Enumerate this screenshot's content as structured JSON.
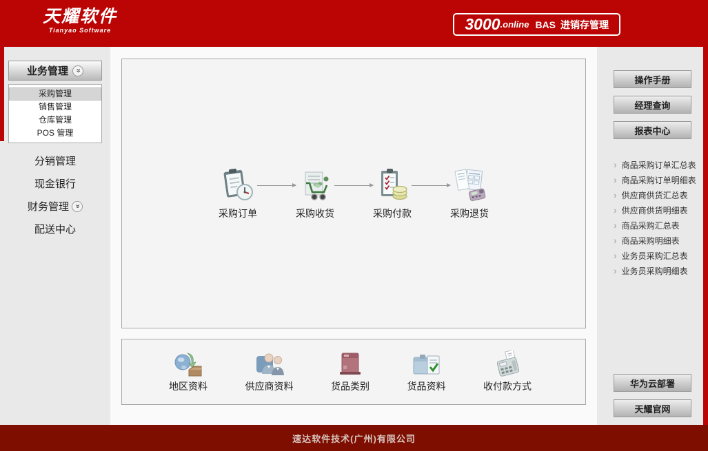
{
  "header": {
    "logo_title": "天耀软件",
    "logo_subtitle": "Tianyao Software",
    "badge": {
      "number": "3000",
      "suffix": ".online",
      "code": "BAS",
      "label": "进销存管理"
    }
  },
  "sidebar": {
    "group_button": "业务管理",
    "submenu": [
      {
        "label": "采购管理",
        "selected": true
      },
      {
        "label": "销售管理",
        "selected": false
      },
      {
        "label": "仓库管理",
        "selected": false
      },
      {
        "label": "POS 管理",
        "selected": false
      }
    ],
    "items": [
      {
        "label": "分销管理",
        "has_chevron": false
      },
      {
        "label": "现金银行",
        "has_chevron": false
      },
      {
        "label": "财务管理",
        "has_chevron": true
      },
      {
        "label": "配送中心",
        "has_chevron": false
      }
    ]
  },
  "main": {
    "flow": [
      {
        "label": "采购订单",
        "icon": "clipboard-clock-icon"
      },
      {
        "label": "采购收货",
        "icon": "cart-receive-icon"
      },
      {
        "label": "采购付款",
        "icon": "clipboard-coins-icon"
      },
      {
        "label": "采购退货",
        "icon": "invoice-terminal-icon"
      }
    ],
    "base_items": [
      {
        "label": "地区资料",
        "icon": "globe-folder-icon"
      },
      {
        "label": "供应商资料",
        "icon": "suppliers-people-icon"
      },
      {
        "label": "货品类别",
        "icon": "red-box-icon"
      },
      {
        "label": "货品资料",
        "icon": "box-checklist-icon"
      },
      {
        "label": "收付款方式",
        "icon": "calculator-icon"
      }
    ]
  },
  "rightbar": {
    "buttons_top": [
      "操作手册",
      "经理查询",
      "报表中心"
    ],
    "reports": [
      "商品采购订单汇总表",
      "商品采购订单明细表",
      "供应商供货汇总表",
      "供应商供货明细表",
      "商品采购汇总表",
      "商品采购明细表",
      "业务员采购汇总表",
      "业务员采购明细表"
    ],
    "buttons_bottom": [
      "华为云部署",
      "天耀官网"
    ]
  },
  "footer": {
    "company": "速达软件技术(广州)有限公司"
  },
  "colors": {
    "header_red": "#bb0404",
    "footer_red": "#7d0e00",
    "sidebar_gray": "#e9e9e9",
    "panel_gray": "#f4f4f4"
  }
}
